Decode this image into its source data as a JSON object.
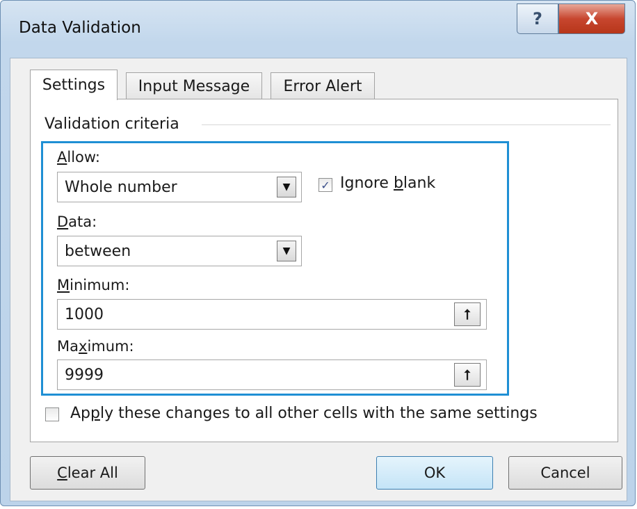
{
  "window": {
    "title": "Data Validation",
    "help_glyph": "?",
    "close_glyph": "X"
  },
  "tabs": [
    {
      "label": "Settings",
      "active": true
    },
    {
      "label": "Input Message",
      "active": false
    },
    {
      "label": "Error Alert",
      "active": false
    }
  ],
  "criteria": {
    "group_label": "Validation criteria",
    "allow": {
      "label_pre": "",
      "label_key": "A",
      "label_post": "llow:",
      "value": "Whole number"
    },
    "ignore_blank": {
      "label_pre": "Ignore ",
      "label_key": "b",
      "label_post": "lank",
      "checked": true
    },
    "data": {
      "label_pre": "",
      "label_key": "D",
      "label_post": "ata:",
      "value": "between"
    },
    "minimum": {
      "label_pre": "",
      "label_key": "M",
      "label_post": "inimum:",
      "value": "1000"
    },
    "maximum": {
      "label_pre": "Ma",
      "label_key": "x",
      "label_post": "imum:",
      "value": "9999"
    }
  },
  "apply_all": {
    "label_pre": "Ap",
    "label_key": "p",
    "label_post": "ly these changes to all other cells with the same settings",
    "checked": false
  },
  "buttons": {
    "clear_all": {
      "label_key": "C",
      "label_post": "lear All"
    },
    "ok": "OK",
    "cancel": "Cancel"
  },
  "icons": {
    "dropdown": "triangle-down",
    "collapse_dialog": "arrow-up-with-bar",
    "check": "check-mark"
  },
  "colors": {
    "focus_border": "#1f8fd4",
    "checkbox_mark": "#3b4f8a",
    "ok_button": "#c4e4f7"
  }
}
